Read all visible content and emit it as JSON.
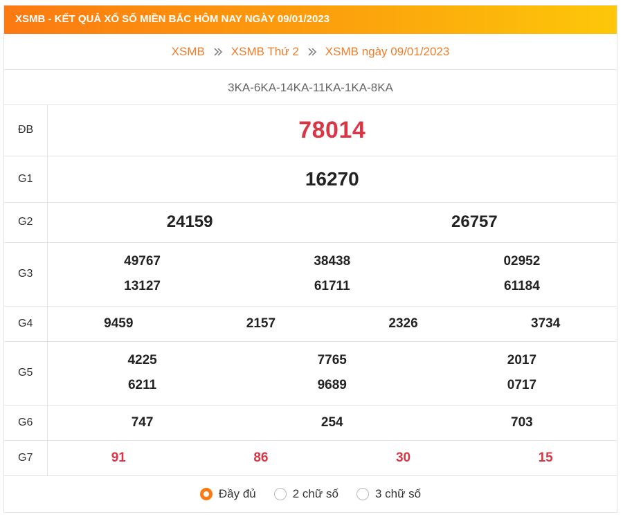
{
  "header": {
    "title": "XSMB - KẾT QUẢ XỔ SỐ MIỀN BẮC HÔM NAY NGÀY 09/01/2023"
  },
  "breadcrumb": {
    "items": [
      {
        "label": "XSMB"
      },
      {
        "label": "XSMB Thứ 2"
      },
      {
        "label": "XSMB ngày 09/01/2023"
      }
    ],
    "separator_icon": "double-chevron-right-icon"
  },
  "codes": "3KA-6KA-14KA-11KA-1KA-8KA",
  "prizes": {
    "db": {
      "label": "ĐB",
      "values": [
        "78014"
      ]
    },
    "g1": {
      "label": "G1",
      "values": [
        "16270"
      ]
    },
    "g2": {
      "label": "G2",
      "values": [
        "24159",
        "26757"
      ]
    },
    "g3": {
      "label": "G3",
      "values": [
        "49767",
        "38438",
        "02952",
        "13127",
        "61711",
        "61184"
      ]
    },
    "g4": {
      "label": "G4",
      "values": [
        "9459",
        "2157",
        "2326",
        "3734"
      ]
    },
    "g5": {
      "label": "G5",
      "values": [
        "4225",
        "7765",
        "2017",
        "6211",
        "9689",
        "0717"
      ]
    },
    "g6": {
      "label": "G6",
      "values": [
        "747",
        "254",
        "703"
      ]
    },
    "g7": {
      "label": "G7",
      "values": [
        "91",
        "86",
        "30",
        "15"
      ]
    }
  },
  "options": {
    "selected": "Đầy đủ",
    "items": [
      {
        "label": "Đầy đủ"
      },
      {
        "label": "2 chữ số"
      },
      {
        "label": "3 chữ số"
      }
    ]
  },
  "colors": {
    "header_gradient_start": "#fb7a12",
    "header_gradient_end": "#fdc70a",
    "link": "#ee7d2b",
    "special_prize": "#d93645",
    "radio_checked": "#fb7a12"
  }
}
